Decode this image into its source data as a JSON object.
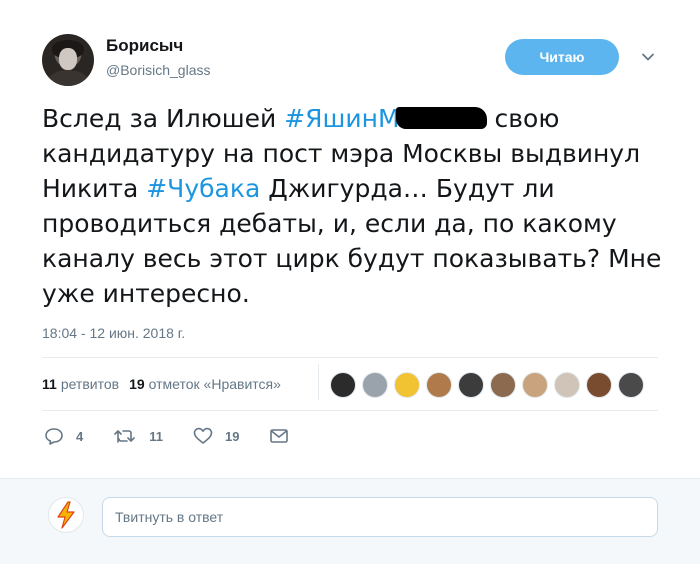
{
  "author": {
    "name": "Борисыч",
    "handle": "@Borisich_glass"
  },
  "follow_button": {
    "label": "Читаю"
  },
  "tweet": {
    "part1": "Вслед за Илюшей ",
    "hashtag1": "#ЯшинМ",
    "part2": " свою кандидатуру на пост мэра Москвы выдвинул Никита ",
    "hashtag2": "#Чубака",
    "part3": " Джигурда… Будут ли проводиться дебаты, и, если да, по какому каналу весь этот цирк будут показывать? Мне уже интересно."
  },
  "timestamp": "18:04 - 12 июн. 2018 г.",
  "stats": {
    "retweets_count": "11",
    "retweets_label": "ретвитов",
    "likes_count": "19",
    "likes_label": "отметок «Нравится»"
  },
  "likers": [
    {
      "name": "liker-1",
      "color": "#2b2b2b"
    },
    {
      "name": "liker-2",
      "color": "#9aa3ab"
    },
    {
      "name": "liker-3",
      "color": "#f1c232"
    },
    {
      "name": "liker-4",
      "color": "#b07a4a"
    },
    {
      "name": "liker-5",
      "color": "#3c3c3c"
    },
    {
      "name": "liker-6",
      "color": "#8c6a4f"
    },
    {
      "name": "liker-7",
      "color": "#c9a27e"
    },
    {
      "name": "liker-8",
      "color": "#d0c4b8"
    },
    {
      "name": "liker-9",
      "color": "#7a4c2f"
    },
    {
      "name": "liker-10",
      "color": "#4a4a4a"
    }
  ],
  "actions": {
    "reply_count": "4",
    "retweet_count": "11",
    "like_count": "19"
  },
  "reply": {
    "placeholder": "Твитнуть в ответ"
  },
  "colors": {
    "accent": "#1b95e0",
    "follow_button": "#5cb5ee",
    "secondary_text": "#657786"
  }
}
